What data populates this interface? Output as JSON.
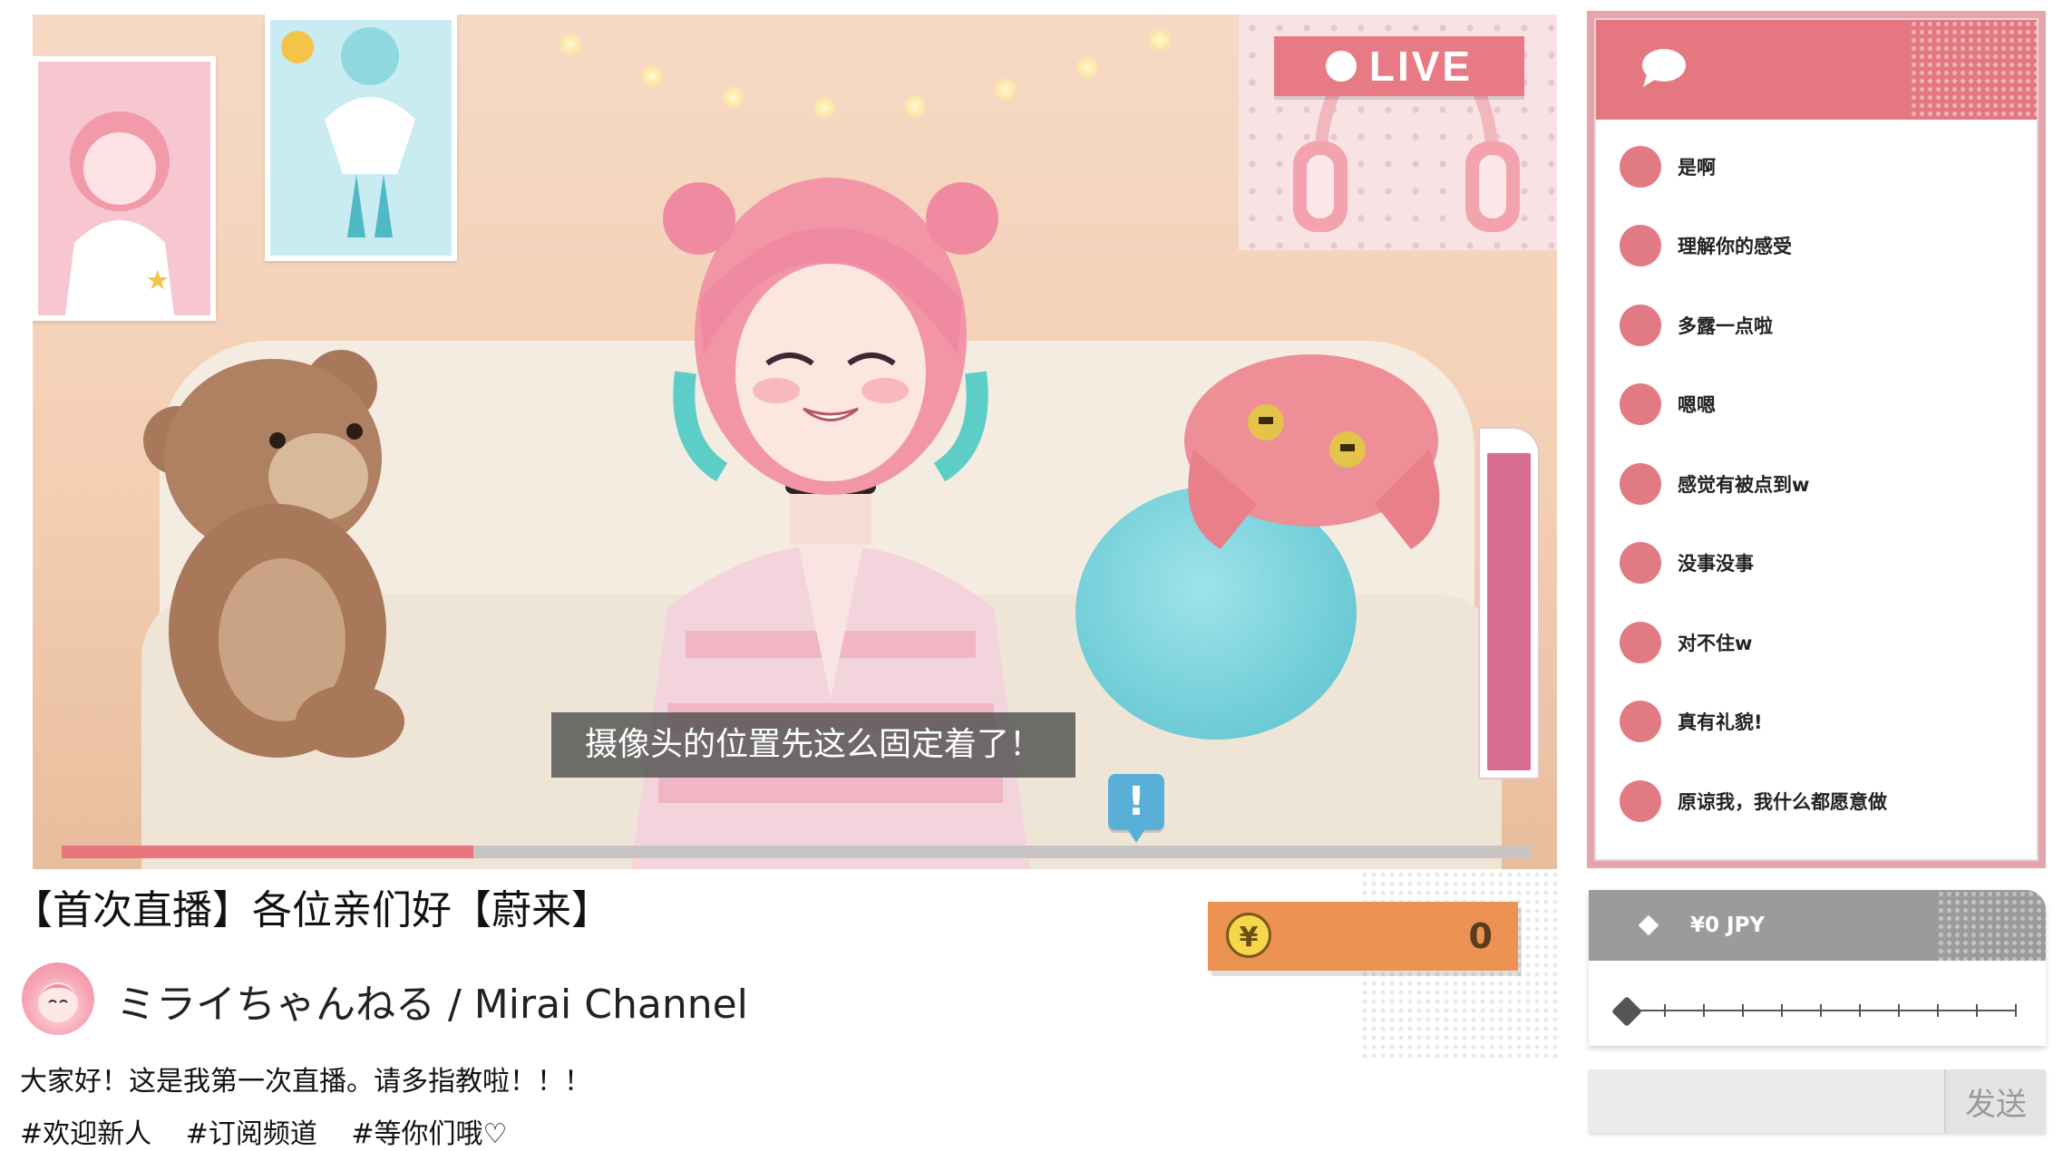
{
  "stream": {
    "live_label": "LIVE",
    "subtitle": "摄像头的位置先这么固定着了！",
    "progress": 0.28,
    "gauge_level": 0.95,
    "alert_symbol": "!"
  },
  "info": {
    "title": "【首次直播】各位亲们好【蔚来】",
    "channel_name": "ミライちゃんねる / Mirai Channel",
    "description": "大家好！这是我第一次直播。请多指教啦！！！",
    "tags": [
      "#欢迎新人",
      "#订阅频道",
      "#等你们哦♡"
    ]
  },
  "coins": {
    "symbol": "¥",
    "count": "0"
  },
  "chat": {
    "messages": [
      "是啊",
      "理解你的感受",
      "多露一点啦",
      "嗯嗯",
      "感觉有被点到w",
      "没事没事",
      "对不住w",
      "真有礼貌!",
      "原谅我，我什么都愿意做"
    ]
  },
  "tip": {
    "amount_label": "¥0 JPY",
    "slider_value": 0,
    "slider_steps": 10
  },
  "send": {
    "button_label": "发送",
    "input_value": ""
  },
  "colors": {
    "accent_pink": "#e4777f",
    "coin_orange": "#ec9252",
    "gauge_pink": "#d86d92",
    "alert_blue": "#58b0d8"
  },
  "icons": {
    "chat": "speech-bubble-icon",
    "coin": "yen-coin-icon",
    "tip": "diamond-icon",
    "alert": "exclamation-icon"
  }
}
